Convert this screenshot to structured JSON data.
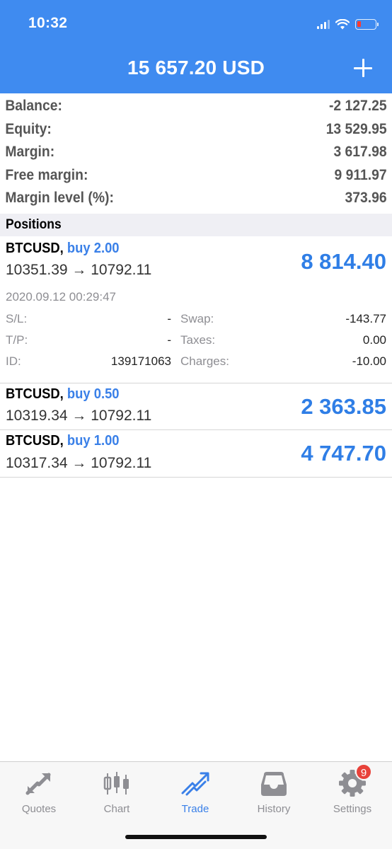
{
  "status_bar": {
    "time": "10:32"
  },
  "header": {
    "title": "15 657.20 USD",
    "add_label": "+"
  },
  "summary": [
    {
      "label": "Balance:",
      "value": "-2 127.25"
    },
    {
      "label": "Equity:",
      "value": "13 529.95"
    },
    {
      "label": "Margin:",
      "value": "3 617.98"
    },
    {
      "label": "Free margin:",
      "value": "9 911.97"
    },
    {
      "label": "Margin level (%):",
      "value": "373.96"
    }
  ],
  "positions_header": "Positions",
  "positions": [
    {
      "symbol": "BTCUSD,",
      "side": "buy 2.00",
      "prices": "10351.39 → 10792.11",
      "profit": "8 814.40",
      "expanded": {
        "date": "2020.09.12 00:29:47",
        "rows": [
          {
            "l_label": "S/L:",
            "l_value": "-",
            "r_label": "Swap:",
            "r_value": "-143.77"
          },
          {
            "l_label": "T/P:",
            "l_value": "-",
            "r_label": "Taxes:",
            "r_value": "0.00"
          },
          {
            "l_label": "ID:",
            "l_value": "139171063",
            "r_label": "Charges:",
            "r_value": "-10.00"
          }
        ]
      }
    },
    {
      "symbol": "BTCUSD,",
      "side": "buy 0.50",
      "prices": "10319.34 → 10792.11",
      "profit": "2 363.85"
    },
    {
      "symbol": "BTCUSD,",
      "side": "buy 1.00",
      "prices": "10317.34 → 10792.11",
      "profit": "4 747.70"
    }
  ],
  "tabbar": {
    "tabs": [
      {
        "label": "Quotes",
        "icon": "quotes-icon"
      },
      {
        "label": "Chart",
        "icon": "chart-icon"
      },
      {
        "label": "Trade",
        "icon": "trade-icon",
        "active": true
      },
      {
        "label": "History",
        "icon": "history-icon"
      },
      {
        "label": "Settings",
        "icon": "settings-icon",
        "badge": "9"
      }
    ]
  },
  "colors": {
    "header_bg": "#3f8bf0",
    "accent": "#3a80e8",
    "profit": "#2f7ee6",
    "badge": "#e8423a"
  }
}
